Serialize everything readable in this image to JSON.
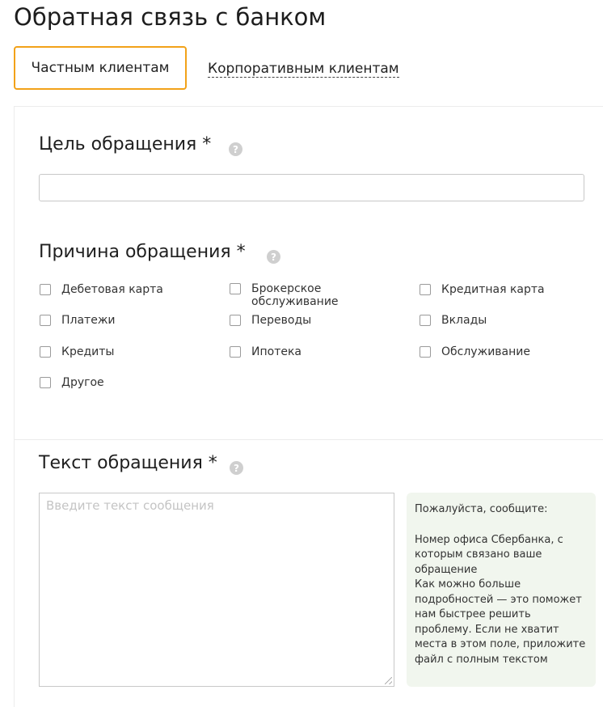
{
  "page": {
    "title": "Обратная связь с банком"
  },
  "tabs": {
    "private": "Частным клиентам",
    "corporate": "Корпоративным клиентам"
  },
  "colors": {
    "accent": "#f2a219",
    "hint_bg": "#f1f6ee",
    "help_icon": "#cfcfcf"
  },
  "purpose": {
    "label": "Цель обращения *",
    "help_icon": "question-circle-icon",
    "value": ""
  },
  "reason": {
    "label": "Причина обращения *",
    "help_icon": "question-circle-icon",
    "options": [
      {
        "label": "Дебетовая карта",
        "checked": false
      },
      {
        "label": "Брокерское обслуживание",
        "checked": false
      },
      {
        "label": "Кредитная карта",
        "checked": false
      },
      {
        "label": "Платежи",
        "checked": false
      },
      {
        "label": "Переводы",
        "checked": false
      },
      {
        "label": "Вклады",
        "checked": false
      },
      {
        "label": "Кредиты",
        "checked": false
      },
      {
        "label": "Ипотека",
        "checked": false
      },
      {
        "label": "Обслуживание",
        "checked": false
      },
      {
        "label": "Другое",
        "checked": false
      }
    ]
  },
  "message": {
    "label": "Текст обращения *",
    "help_icon": "question-circle-icon",
    "placeholder": "Введите текст сообщения",
    "value": ""
  },
  "hint": {
    "intro": "Пожалуйста, сообщите:",
    "items": [
      "Номер офиса Сбербанка, с которым связано ваше обращение",
      "Как можно больше подробностей — это поможет нам быстрее решить проблему. Если не хватит места в этом поле, приложите файл с полным текстом"
    ]
  }
}
